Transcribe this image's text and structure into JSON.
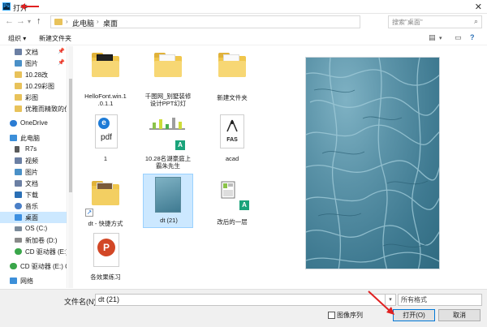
{
  "window": {
    "title": "打开",
    "app_icon_text": "Ps",
    "close_glyph": "✕"
  },
  "address": {
    "crumbs": [
      "此电脑",
      "桌面"
    ],
    "separator": "›",
    "search_placeholder": "搜索\"桌面\""
  },
  "toolbar": {
    "organize_label": "组织 ▾",
    "new_folder_label": "新建文件夹"
  },
  "sidebar": {
    "items": [
      {
        "label": "文档",
        "icon_color": "#6b7fa3",
        "pinned": true,
        "pin_glyph": "📌"
      },
      {
        "label": "图片",
        "icon_color": "#4a90c7",
        "pinned": true,
        "pin_glyph": "📌"
      },
      {
        "label": "10.28改",
        "icon_color": "#e8c25a"
      },
      {
        "label": "10.29彩图",
        "icon_color": "#e8c25a"
      },
      {
        "label": "彩图",
        "icon_color": "#e8c25a"
      },
      {
        "label": "优雅而精致的住",
        "icon_color": "#e8c25a"
      },
      {
        "label": "OneDrive",
        "icon_color": "#2b7cd3"
      },
      {
        "label": "此电脑",
        "icon_color": "#3c8fd9"
      },
      {
        "label": "R7s",
        "icon_color": "#5a5a5a"
      },
      {
        "label": "视频",
        "icon_color": "#6b7fa3"
      },
      {
        "label": "图片",
        "icon_color": "#4a90c7"
      },
      {
        "label": "文档",
        "icon_color": "#6b7fa3"
      },
      {
        "label": "下载",
        "icon_color": "#2a6fb5"
      },
      {
        "label": "音乐",
        "icon_color": "#4a7fc7"
      },
      {
        "label": "桌面",
        "icon_color": "#3d8fe0",
        "selected": true
      },
      {
        "label": "OS (C:)",
        "icon_color": "#7a8a9a"
      },
      {
        "label": "新加卷 (D:)",
        "icon_color": "#8a8a8a"
      },
      {
        "label": "CD 驱动器 (E:) C",
        "icon_color": "#3aa64a"
      },
      {
        "label": "CD 驱动器 (E:) OI",
        "icon_color": "#3aa64a"
      },
      {
        "label": "网络",
        "icon_color": "#3c8fd9"
      }
    ]
  },
  "files": [
    {
      "label": "HelloFont.win.1\n.0.1.1",
      "kind": "folder-dark"
    },
    {
      "label": "千图网_别墅装修\n设计PPT幻灯",
      "kind": "folder-doc"
    },
    {
      "label": "新建文件夹",
      "kind": "folder-doc"
    },
    {
      "label": "1",
      "kind": "pdf"
    },
    {
      "label": "10.28名湖豪庭上\n霸朱先生",
      "kind": "chart"
    },
    {
      "label": "acad",
      "kind": "fas"
    },
    {
      "label": "dt - 快捷方式",
      "kind": "shortcut"
    },
    {
      "label": "dt (21)",
      "kind": "image",
      "selected": true
    },
    {
      "label": "改后的一层",
      "kind": "plan"
    },
    {
      "label": "各效果练习",
      "kind": "ppt"
    }
  ],
  "icons": {
    "pdf_text": "pdf",
    "fas_text": "FAS",
    "ppt_letter": "P",
    "green_a": "A"
  },
  "bottom": {
    "filename_label": "文件名(N):",
    "filename_value": "dt (21)",
    "type_value": "所有格式",
    "sequence_label": "图像序列",
    "open_label": "打开(O)",
    "cancel_label": "取消"
  },
  "colors": {
    "accent": "#0078d7",
    "selection": "#cce8ff",
    "annotation_red": "#e02020"
  }
}
